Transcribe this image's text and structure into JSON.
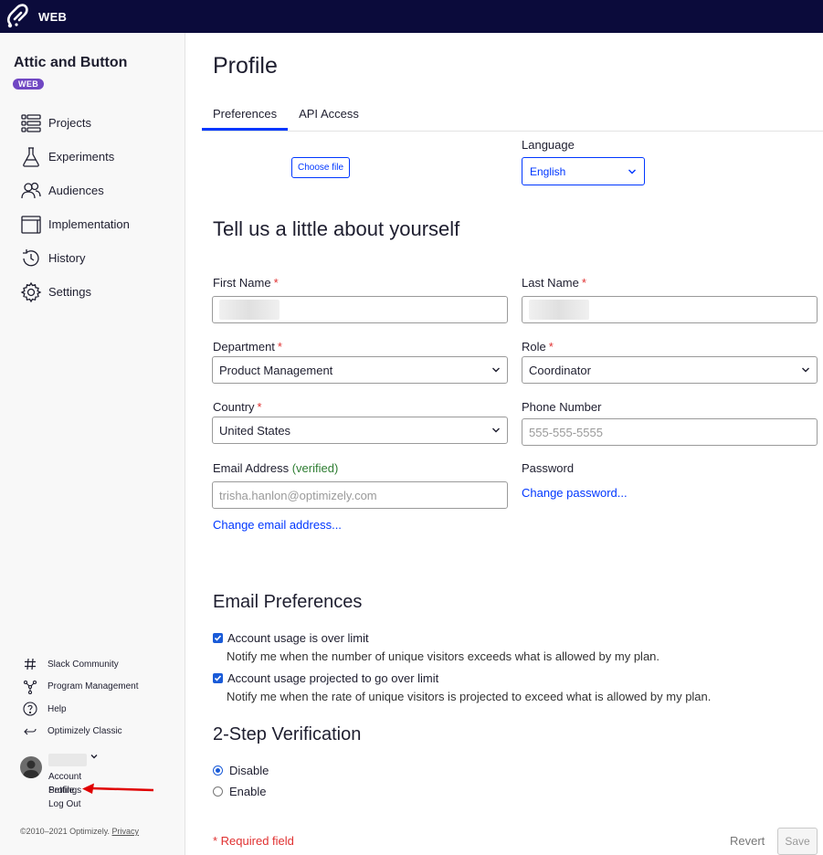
{
  "topbar": {
    "brand": "WEB"
  },
  "sidebar": {
    "project_title": "Attic and Button",
    "project_badge": "WEB",
    "nav": [
      {
        "label": "Projects",
        "icon": "projects-icon"
      },
      {
        "label": "Experiments",
        "icon": "flask-icon"
      },
      {
        "label": "Audiences",
        "icon": "audiences-icon"
      },
      {
        "label": "Implementation",
        "icon": "implementation-icon"
      },
      {
        "label": "History",
        "icon": "history-icon"
      },
      {
        "label": "Settings",
        "icon": "gear-icon"
      }
    ],
    "footer_links": [
      {
        "label": "Slack Community",
        "icon": "hash-icon"
      },
      {
        "label": "Program Management",
        "icon": "network-icon"
      },
      {
        "label": "Help",
        "icon": "question-icon"
      },
      {
        "label": "Optimizely Classic",
        "icon": "back-arrow-icon"
      }
    ],
    "user_menu": {
      "account_settings": "Account Settings",
      "profile": "Profile",
      "log_out": "Log Out"
    },
    "copyright": "©2010–2021 Optimizely.",
    "privacy": "Privacy"
  },
  "main": {
    "title": "Profile",
    "tabs": [
      {
        "label": "Preferences",
        "active": true
      },
      {
        "label": "API Access",
        "active": false
      }
    ],
    "choose_file": "Choose file",
    "language_label": "Language",
    "language_value": "English",
    "about_title": "Tell us a little about yourself",
    "first_name_label": "First Name",
    "last_name_label": "Last Name",
    "required_marker": "*",
    "department_label": "Department",
    "department_value": "Product Management",
    "role_label": "Role",
    "role_value": "Coordinator",
    "country_label": "Country",
    "country_value": "United States",
    "phone_label": "Phone Number",
    "phone_placeholder": "555-555-5555",
    "email_label": "Email Address",
    "email_verified": "(verified)",
    "email_placeholder": "trisha.hanlon@optimizely.com",
    "change_email": "Change email address...",
    "password_label": "Password",
    "change_password": "Change password...",
    "email_prefs_title": "Email Preferences",
    "prefs": [
      {
        "title": "Account usage is over limit",
        "desc": "Notify me when the number of unique visitors exceeds what is allowed by my plan.",
        "checked": true
      },
      {
        "title": "Account usage projected to go over limit",
        "desc": "Notify me when the rate of unique visitors is projected to exceed what is allowed by my plan.",
        "checked": true
      }
    ],
    "two_step_title": "2-Step Verification",
    "two_step_options": [
      {
        "label": "Disable",
        "selected": true
      },
      {
        "label": "Enable",
        "selected": false
      }
    ],
    "required_note": "* Required field",
    "revert": "Revert",
    "save": "Save"
  },
  "colors": {
    "topbar": "#0b0b3b",
    "accent": "#0037ff",
    "badge": "#7047c3",
    "required": "#e03030",
    "verified": "#2e7d32"
  }
}
